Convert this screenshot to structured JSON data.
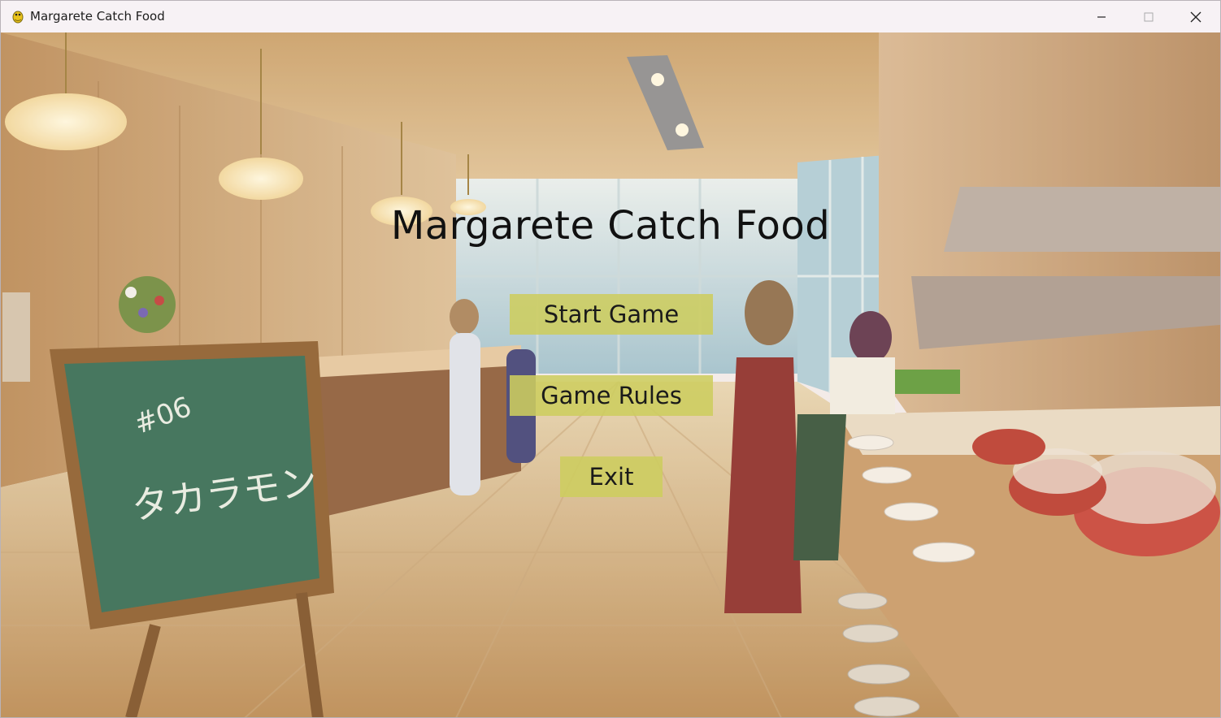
{
  "window": {
    "title": "Margarete Catch Food",
    "controls": {
      "minimize": "minimize-icon",
      "maximize": "maximize-icon",
      "close": "close-icon"
    }
  },
  "menu": {
    "title": "Margarete Catch Food",
    "buttons": {
      "start": "Start Game",
      "rules": "Game Rules",
      "exit": "Exit"
    }
  },
  "scene": {
    "chalkboard_number": "#06",
    "chalkboard_text": "タカラモン"
  },
  "colors": {
    "button_fill": "#cdcd5f",
    "title_text": "#111111"
  }
}
